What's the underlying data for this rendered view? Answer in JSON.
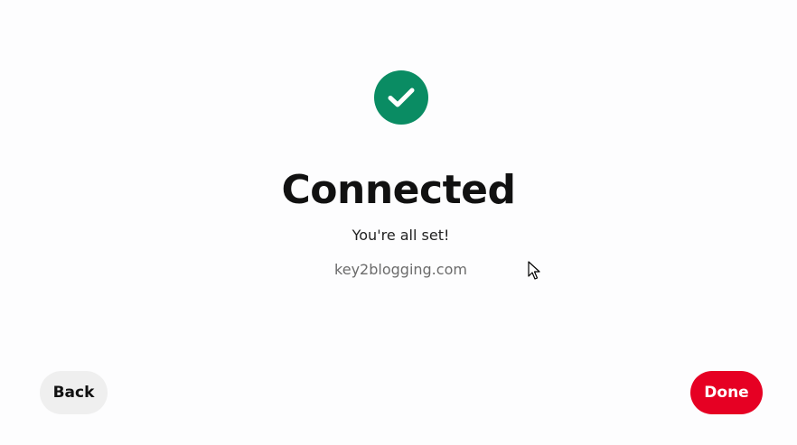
{
  "status": {
    "icon": "checkmark-icon",
    "color": "#0a8c63",
    "title": "Connected",
    "message": "You're all set!",
    "site": "key2blogging.com"
  },
  "actions": {
    "back_label": "Back",
    "done_label": "Done",
    "done_color": "#e60023"
  }
}
